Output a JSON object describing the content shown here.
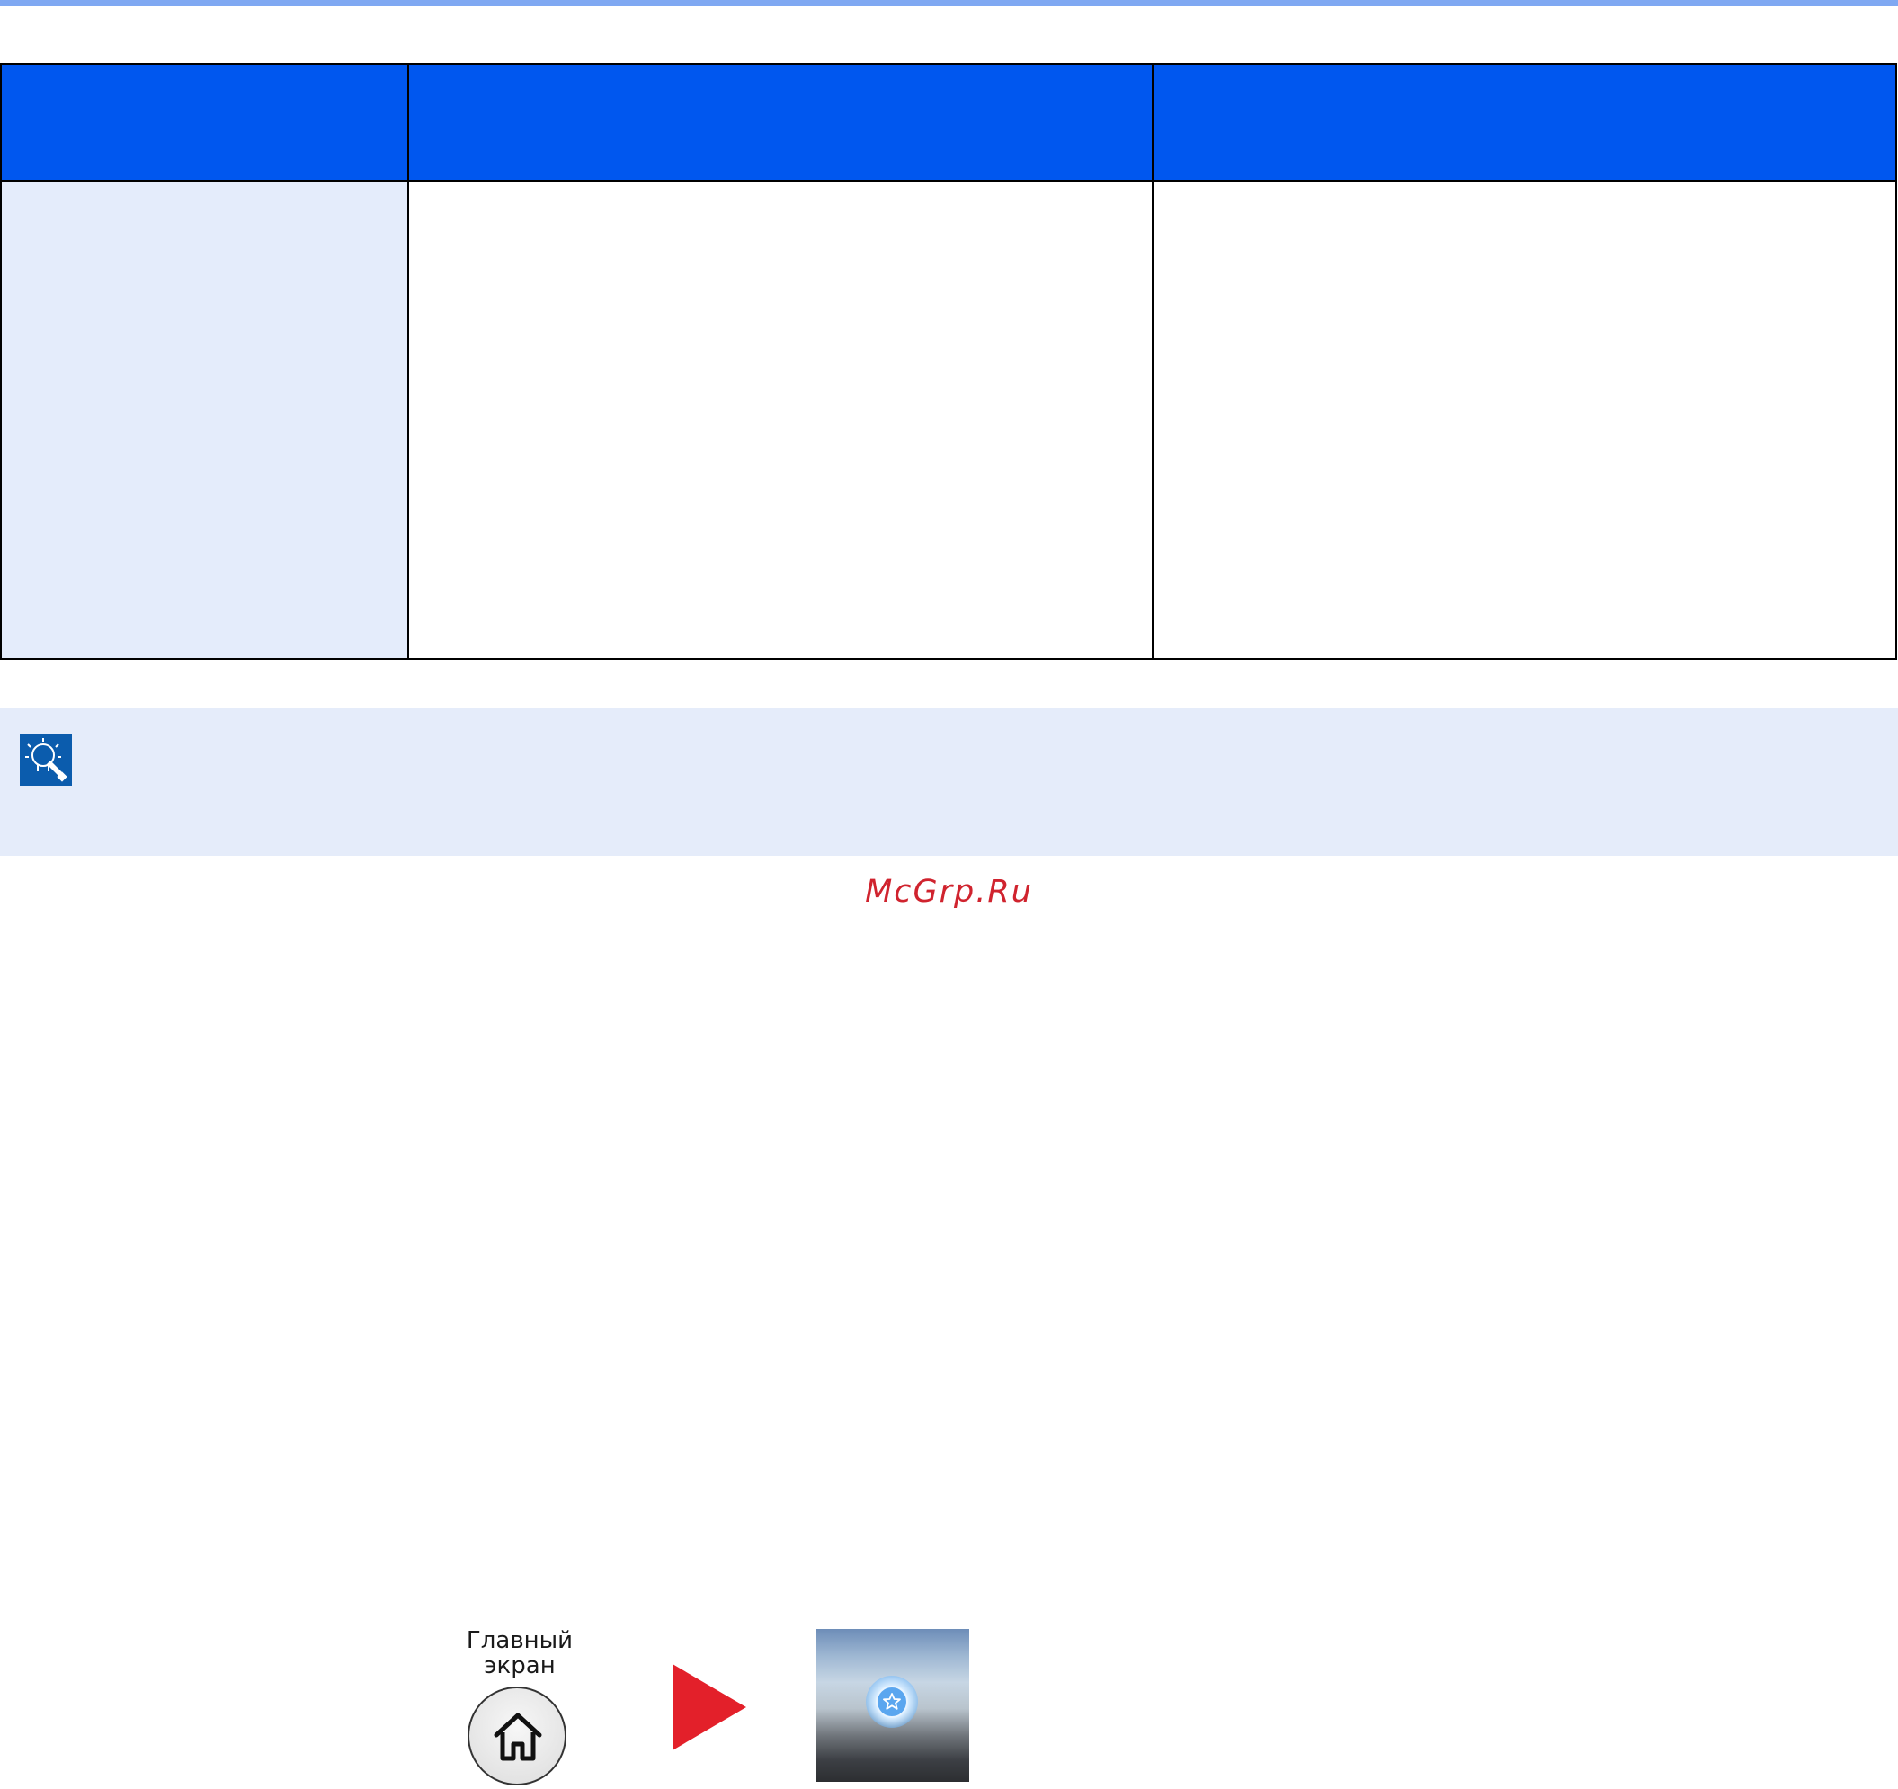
{
  "table": {
    "header_cells": [
      "",
      "",
      ""
    ],
    "body_cells": [
      "",
      "",
      ""
    ]
  },
  "note": {
    "icon": "lightbulb-note-icon",
    "text": ""
  },
  "watermark": {
    "text": "McGrp.Ru"
  },
  "controls": {
    "home_button_label": "Главный\nэкран",
    "home_icon": "home-icon",
    "arrow_icon": "right-arrow-icon",
    "favorites_icon": "favorites-star-icon"
  },
  "colors": {
    "header_blue": "#0057ef",
    "first_column_fill": "#e4ecfb",
    "note_fill": "#e5ecfa",
    "note_icon_blue": "#0b5cad",
    "watermark_red": "#d0232e",
    "arrow_red": "#e3202a",
    "top_rule": "#7fa8f2"
  }
}
